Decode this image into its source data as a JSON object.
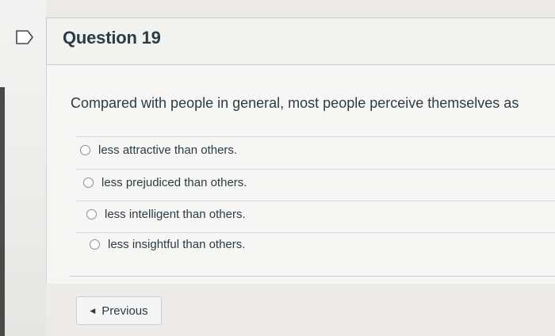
{
  "question": {
    "title": "Question 19",
    "text": "Compared with people in general, most people perceive themselves as",
    "answers": [
      {
        "label": "less attractive than others."
      },
      {
        "label": "less prejudiced than others."
      },
      {
        "label": "less intelligent than others."
      },
      {
        "label": "less insightful than others."
      }
    ]
  },
  "navigation": {
    "previous_label": "Previous",
    "previous_icon": "caret-left-icon"
  },
  "flag": {
    "icon": "flag-question-icon"
  },
  "colors": {
    "text": "#2d3b45",
    "border": "#c9cbcd"
  }
}
